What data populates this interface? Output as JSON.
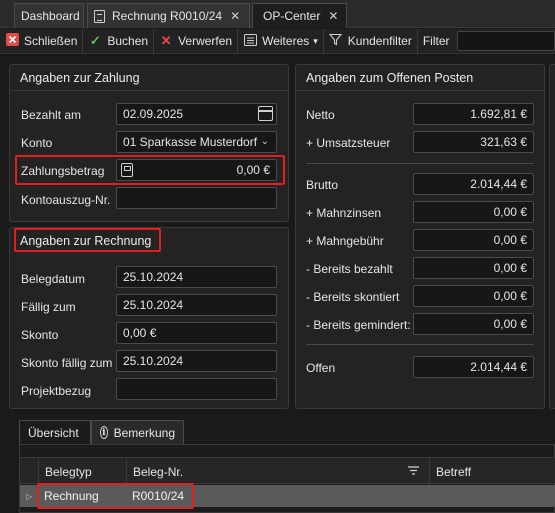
{
  "tabs": [
    {
      "label": "Dashboard"
    },
    {
      "label": "Rechnung R0010/24",
      "close": "✕"
    },
    {
      "label": "OP-Center",
      "close": "✕"
    }
  ],
  "toolbar": {
    "close": "Schließen",
    "book": "Buchen",
    "discard": "Verwerfen",
    "more": "Weiteres",
    "customer_filter": "Kundenfilter",
    "filter": "Filter"
  },
  "payment": {
    "title": "Angaben zur Zahlung",
    "paid_on_label": "Bezahlt am",
    "paid_on": "02.09.2025",
    "account_label": "Konto",
    "account": "01 Sparkasse Musterdorf",
    "amount_label": "Zahlungsbetrag",
    "amount": "0,00 €",
    "statement_label": "Kontoauszug-Nr.",
    "statement": ""
  },
  "invoice": {
    "title": "Angaben zur Rechnung",
    "doc_date_label": "Belegdatum",
    "doc_date": "25.10.2024",
    "due_label": "Fällig zum",
    "due": "25.10.2024",
    "discount_label": "Skonto",
    "discount": "0,00 €",
    "discount_due_label": "Skonto fällig zum",
    "discount_due": "25.10.2024",
    "project_label": "Projektbezug",
    "project": ""
  },
  "open_item": {
    "title": "Angaben zum Offenen Posten",
    "net_label": "Netto",
    "net": "1.692,81 €",
    "vat_label": "+ Umsatzsteuer",
    "vat": "321,63 €",
    "gross_label": "Brutto",
    "gross": "2.014,44 €",
    "dunning_interest_label": "+ Mahnzinsen",
    "dunning_interest": "0,00 €",
    "dunning_fee_label": "+ Mahngebühr",
    "dunning_fee": "0,00 €",
    "paid_label": "- Bereits bezahlt",
    "paid": "0,00 €",
    "discounted_label": "- Bereits skontiert",
    "discounted": "0,00 €",
    "reduced_label": "- Bereits gemindert:",
    "reduced": "0,00 €",
    "open_label": "Offen",
    "open": "2.014,44 €"
  },
  "bottom_tabs": [
    {
      "label": "Übersicht"
    },
    {
      "label": "Bemerkung"
    }
  ],
  "grid": {
    "columns": [
      "Belegtyp",
      "Beleg-Nr.",
      "Betreff"
    ],
    "rows": [
      {
        "type": "Rechnung",
        "number": "R0010/24",
        "subject": ""
      }
    ]
  },
  "colors": {
    "highlight": "#e02020",
    "selected_row": "#5a5a5a"
  }
}
